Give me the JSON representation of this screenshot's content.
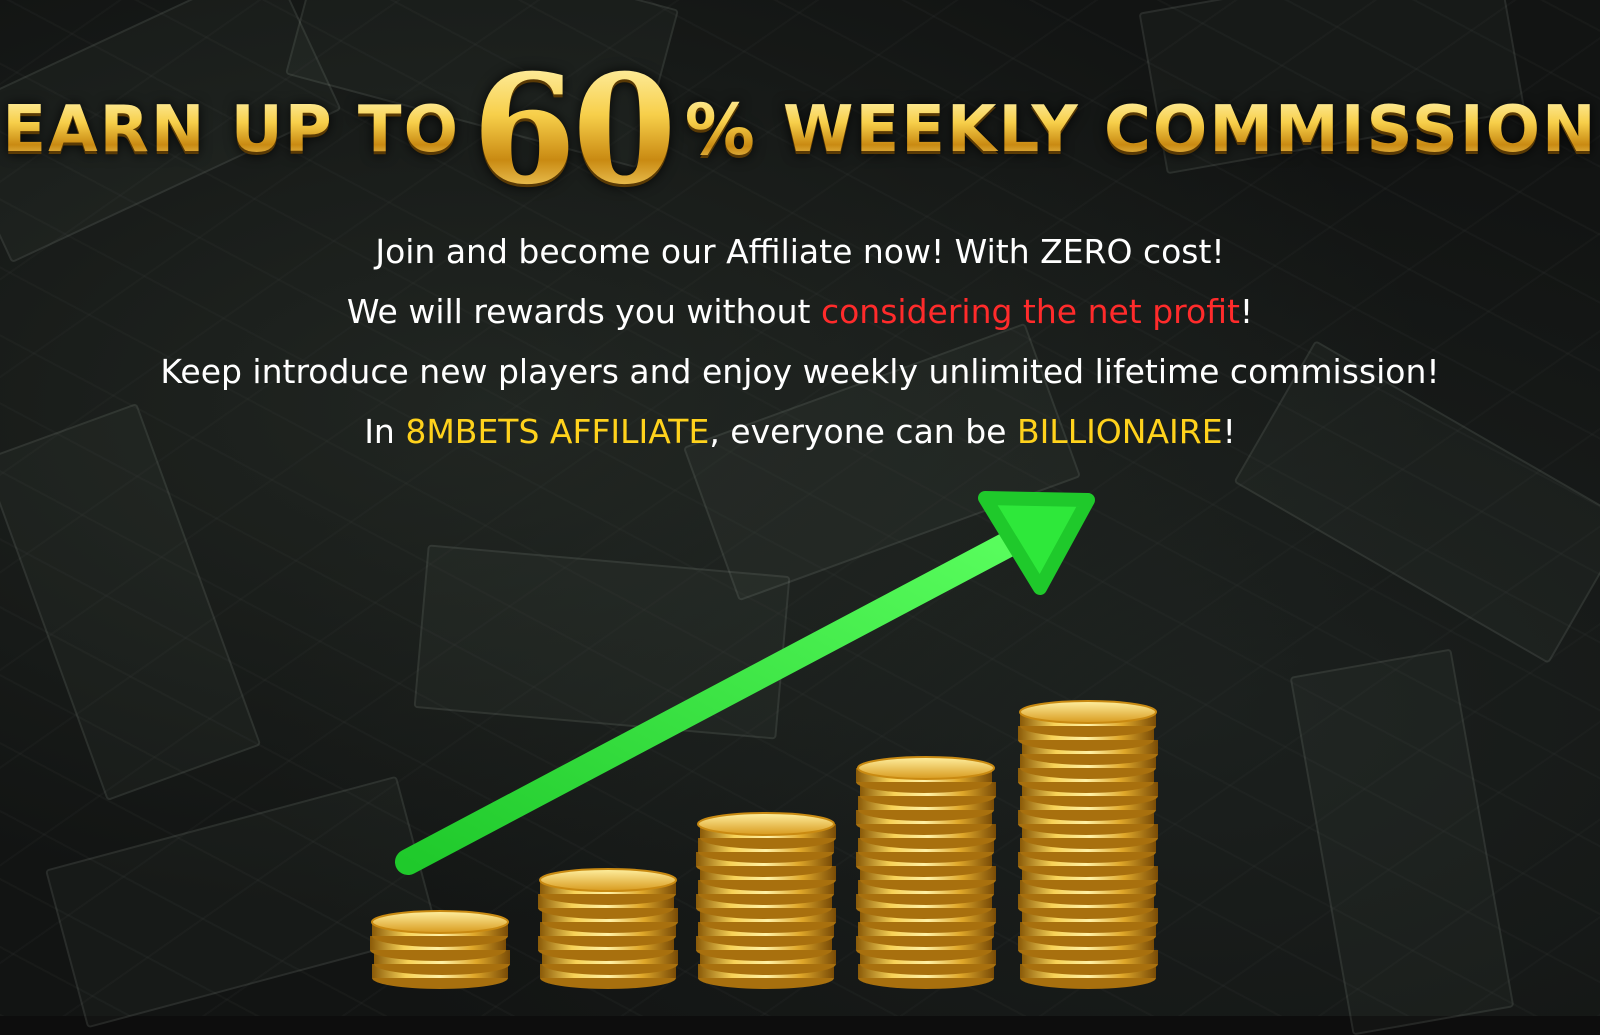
{
  "headline": {
    "prefix": "EARN UP TO",
    "number": "60",
    "percent": "%",
    "suffix": "WEEKLY COMMISSION"
  },
  "lines": {
    "line1": "Join and become our Affiliate now! With ZERO cost!",
    "line2_a": "We will rewards you without ",
    "line2_highlight": "considering the net profit",
    "line2_b": "!",
    "line3": "Keep introduce new players and enjoy weekly unlimited lifetime commission!",
    "line4_a": "In ",
    "line4_brand": "8MBETS AFFILIATE",
    "line4_b": ", everyone can be ",
    "line4_highlight": "BILLIONAIRE",
    "line4_c": "!"
  },
  "colors": {
    "gold": "#f3c640",
    "highlight_red": "#ff2b2b",
    "highlight_yellow": "#ffd21c",
    "arrow_green": "#2ee83a"
  },
  "graphic": {
    "arrow_icon": "growth-arrow-icon",
    "coin_stack_icon": "gold-coin-stack-icon",
    "coin_stack_levels": [
      4,
      7,
      11,
      15,
      19
    ]
  }
}
